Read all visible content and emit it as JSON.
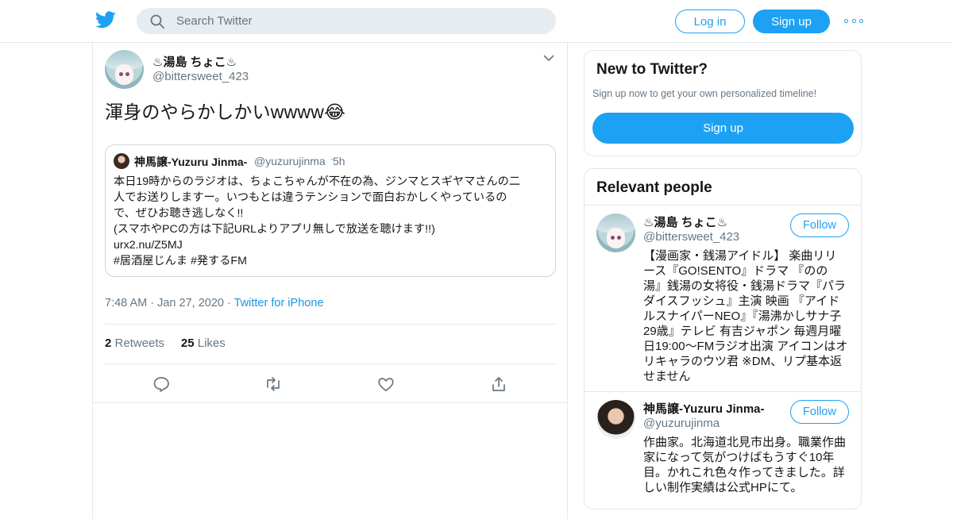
{
  "header": {
    "search_placeholder": "Search Twitter",
    "login_label": "Log in",
    "signup_label": "Sign up"
  },
  "tweet": {
    "author_name": "♨湯島 ちょこ♨",
    "author_handle": "@bittersweet_423",
    "text": "渾身のやらかしかいwwww😂",
    "quote": {
      "author_name": "神馬譲-Yuzuru Jinma-",
      "author_handle": "@yuzurujinma",
      "separator": "·",
      "time": "5h",
      "lines": [
        "本日19時からのラジオは、ちょこちゃんが不在の為、ジンマとスギヤマさんの二",
        "人でお送りしますー。いつもとは違うテンションで面白おかしくやっているの",
        "で、ぜひお聴き逃しなく!!",
        "(スマホやPCの方は下記URLよりアプリ無しで放送を聴けます!!)",
        "urx2.nu/Z5MJ",
        "#居酒屋じんま #発するFM"
      ]
    },
    "time": "7:48 AM",
    "date": "Jan 27, 2020",
    "separator": "·",
    "source": "Twitter for iPhone",
    "retweets_count": "2",
    "retweets_label": "Retweets",
    "likes_count": "25",
    "likes_label": "Likes"
  },
  "sidebar": {
    "new_title": "New to Twitter?",
    "new_subtitle": "Sign up now to get your own personalized timeline!",
    "new_signup_label": "Sign up",
    "relevant_title": "Relevant people",
    "people": [
      {
        "name": "♨湯島 ちょこ♨",
        "handle": "@bittersweet_423",
        "follow_label": "Follow",
        "bio_lines": [
          "【漫画家・銭湯アイドル】 楽曲リリ",
          "ース『GO!SENTO』ドラマ 『のの",
          "湯』銭湯の女将役・銭湯ドラマ『パラ",
          "ダイスフッシュ』主演 映画 『アイド",
          "ルスナイパーNEO』『湯沸かしサナ子",
          "29歳』テレビ 有吉ジャポン 毎週月曜",
          "日19:00〜FMラジオ出演 アイコンはオ",
          "リキャラのウツ君 ※DM、リプ基本返",
          "せません"
        ]
      },
      {
        "name": "神馬譲-Yuzuru Jinma-",
        "handle": "@yuzurujinma",
        "follow_label": "Follow",
        "bio_lines": [
          "作曲家。北海道北見市出身。職業作曲",
          "家になって気がつけばもうすぐ10年",
          "目。かれこれ色々作ってきました。詳",
          "しい制作実績は公式HPにて。"
        ]
      }
    ]
  },
  "colors": {
    "accent": "#1da1f2",
    "secondary_text": "#657786",
    "border": "#e1e8ed"
  }
}
